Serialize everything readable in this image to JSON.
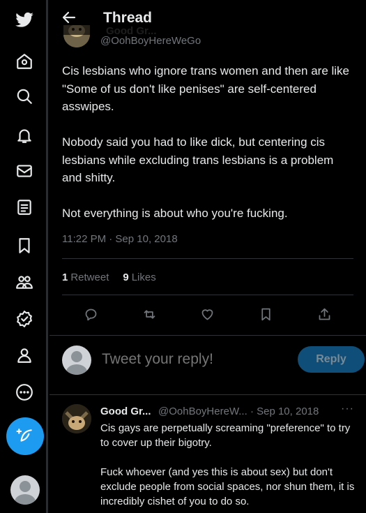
{
  "nav": {
    "items": [
      "twitter-logo",
      "home",
      "explore",
      "notifications",
      "messages",
      "lists",
      "bookmarks",
      "communities",
      "verified",
      "profile",
      "more"
    ]
  },
  "header": {
    "title": "Thread",
    "name_partial": "Good Gr..."
  },
  "tweet": {
    "handle": "@OohBoyHereWeGo",
    "text": "Cis lesbians who ignore trans women and then are like \"Some of us don't like penises\" are self-centered asswipes.\n\nNobody said you had to like dick, but centering cis lesbians while excluding trans lesbians is a problem and shitty.\n\nNot everything is about who you're fucking.",
    "timestamp": "11:22 PM · Sep 10, 2018",
    "retweets_count": "1",
    "retweets_label": "Retweet",
    "likes_count": "9",
    "likes_label": "Likes"
  },
  "reply_box": {
    "placeholder": "Tweet your reply!",
    "button": "Reply"
  },
  "reply": {
    "name": "Good Gr...",
    "meta": "@OohBoyHereW... · Sep 10, 2018",
    "more": "···",
    "text": "Cis gays are perpetually screaming \"preference\" to try to cover up their bigotry.\n\nFuck whoever (and yes this is about sex) but don't exclude people from social spaces, nor shun them, it is incredibly cishet of you to do so."
  },
  "colors": {
    "background": "#000000",
    "accent": "#1d9bf0",
    "muted": "#71767b",
    "text": "#e7e9ea",
    "divider": "#2f3336"
  }
}
